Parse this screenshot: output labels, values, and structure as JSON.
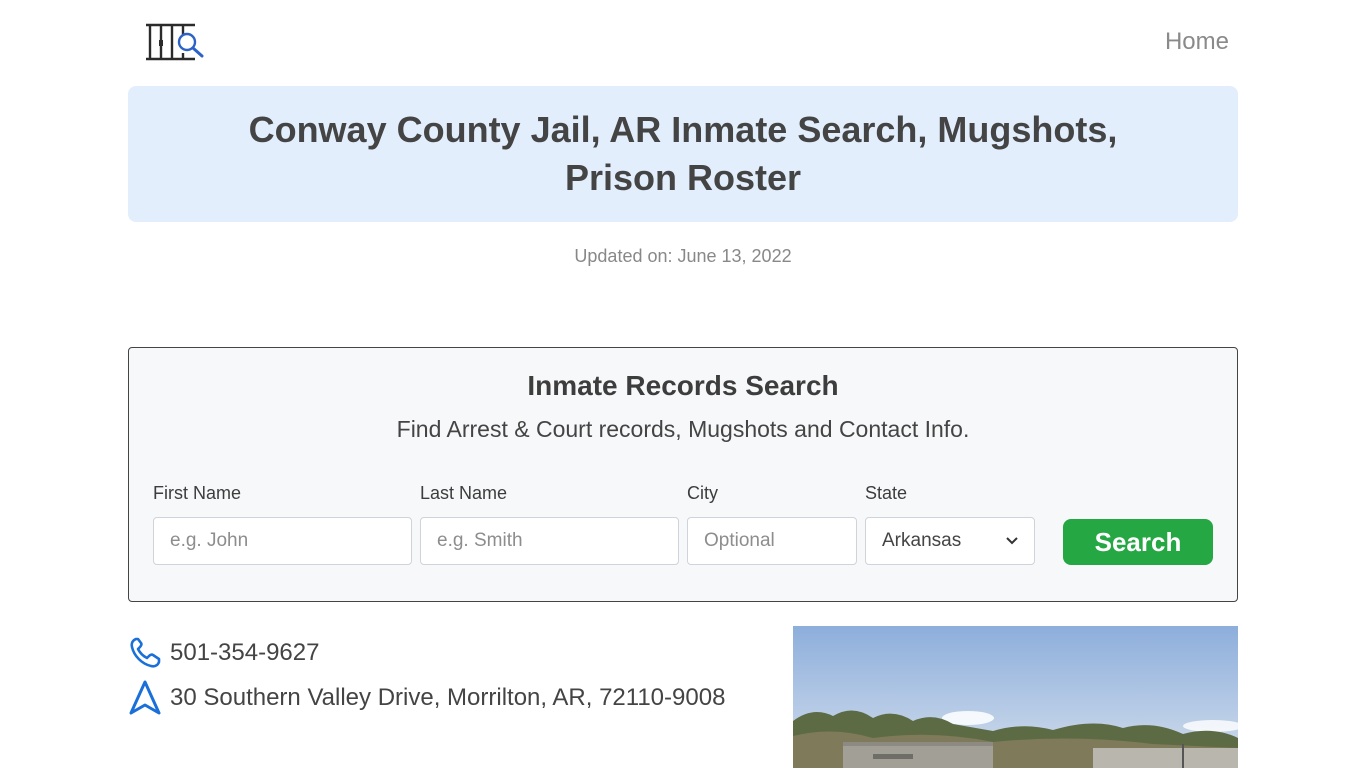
{
  "header": {
    "logo_icon": "jail-bars-search-icon",
    "nav_home": "Home"
  },
  "page": {
    "title": "Conway County Jail, AR Inmate Search, Mugshots, Prison Roster",
    "updated": "Updated on: June 13, 2022"
  },
  "search": {
    "title": "Inmate Records Search",
    "subtitle": "Find Arrest & Court records, Mugshots and Contact Info.",
    "first_name_label": "First Name",
    "first_name_placeholder": "e.g. John",
    "last_name_label": "Last Name",
    "last_name_placeholder": "e.g. Smith",
    "city_label": "City",
    "city_placeholder": "Optional",
    "state_label": "State",
    "state_value": "Arkansas",
    "button_label": "Search",
    "button_color": "#25a744"
  },
  "contact": {
    "phone_icon": "phone-icon",
    "phone": "501-354-9627",
    "address_icon": "navigation-arrow-icon",
    "address": "30 Southern Valley Drive, Morrilton, AR, 72110-9008"
  },
  "colors": {
    "banner_bg": "#e3eefd",
    "accent_blue": "#1a6fd9"
  }
}
